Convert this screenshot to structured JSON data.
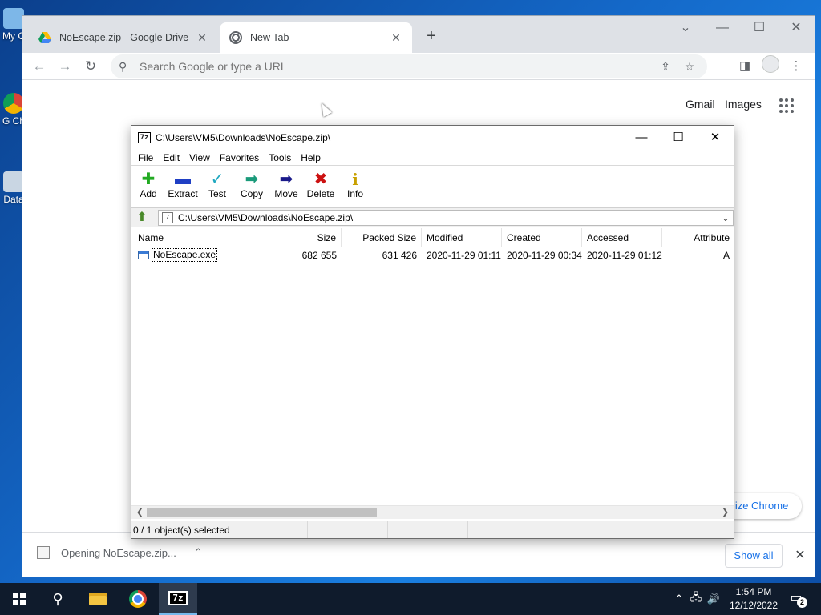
{
  "desktop": {
    "icons": [
      {
        "label": "My C",
        "icon": "computer-icon"
      },
      {
        "label": "G Ch",
        "icon": "chrome-icon"
      },
      {
        "label": "Data",
        "icon": "data-icon"
      }
    ]
  },
  "chrome": {
    "tabs": [
      {
        "title": "NoEscape.zip - Google Drive",
        "icon": "google-drive-icon",
        "active": false
      },
      {
        "title": "New Tab",
        "icon": "chrome-icon",
        "active": true
      }
    ],
    "omnibox": {
      "placeholder": "Search Google or type a URL",
      "value": ""
    },
    "ntp": {
      "gmail": "Gmail",
      "images": "Images",
      "customize": "Customize Chrome",
      "customize_visible": "mize Chrome"
    },
    "download": {
      "label": "Opening NoEscape.zip...",
      "show_all": "Show all"
    }
  },
  "sevenzip": {
    "title": "C:\\Users\\VM5\\Downloads\\NoEscape.zip\\",
    "menu": [
      "File",
      "Edit",
      "View",
      "Favorites",
      "Tools",
      "Help"
    ],
    "toolbar": [
      {
        "label": "Add",
        "icon": "add-icon",
        "color": "#22aa22"
      },
      {
        "label": "Extract",
        "icon": "extract-icon",
        "color": "#1f3fc4"
      },
      {
        "label": "Test",
        "icon": "test-icon",
        "color": "#1fa8c0"
      },
      {
        "label": "Copy",
        "icon": "copy-icon",
        "color": "#1a9a7a"
      },
      {
        "label": "Move",
        "icon": "move-icon",
        "color": "#1a1a8a"
      },
      {
        "label": "Delete",
        "icon": "delete-icon",
        "color": "#cc1111"
      },
      {
        "label": "Info",
        "icon": "info-icon",
        "color": "#c8a000"
      }
    ],
    "path": "C:\\Users\\VM5\\Downloads\\NoEscape.zip\\",
    "columns": [
      "Name",
      "Size",
      "Packed Size",
      "Modified",
      "Created",
      "Accessed",
      "Attribute"
    ],
    "rows": [
      {
        "name": "NoEscape.exe",
        "size": "682 655",
        "packed": "631 426",
        "modified": "2020-11-29 01:11",
        "created": "2020-11-29 00:34",
        "accessed": "2020-11-29 01:12",
        "attr": "A"
      }
    ],
    "status": "0 / 1 object(s) selected"
  },
  "taskbar": {
    "time": "1:54 PM",
    "date": "12/12/2022",
    "notifications": "2"
  }
}
